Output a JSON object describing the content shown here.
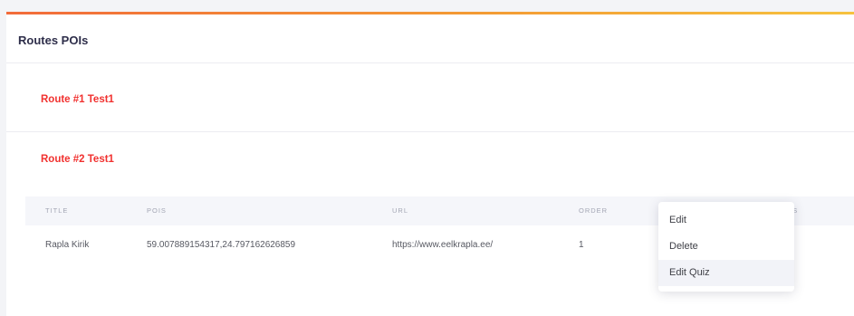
{
  "card": {
    "title": "Routes POIs"
  },
  "routes": [
    {
      "label": "Route #1 Test1"
    },
    {
      "label": "Route #2 Test1"
    }
  ],
  "table": {
    "columns": [
      "TITLE",
      "POIS",
      "URL",
      "ORDER",
      "ONS"
    ],
    "rows": [
      {
        "title": "Rapla Kirik",
        "pois": "59.007889154317,24.797162626859",
        "url": "https://www.eelkrapla.ee/",
        "order": "1"
      }
    ]
  },
  "dropdown": {
    "items": [
      "Edit",
      "Delete",
      "Edit Quiz"
    ],
    "active_index": 2
  },
  "colors": {
    "accent_start": "#f26b3a",
    "accent_end": "#f6c23e",
    "route_label": "#f1312f",
    "title": "#2e2e4a"
  }
}
